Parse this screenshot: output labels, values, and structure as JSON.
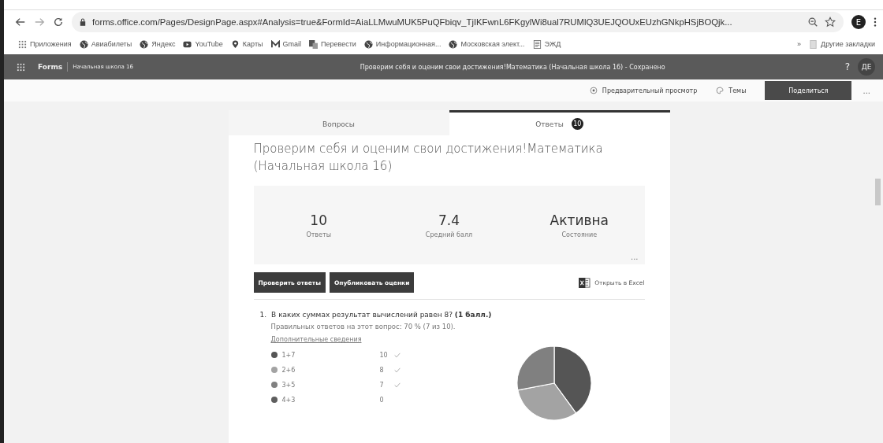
{
  "browser": {
    "url": "forms.office.com/Pages/DesignPage.aspx#Analysis=true&FormId=AiaLLMwuMUK5PuQFbiqv_TjIKFwnL6FKgylWi8ual7RUMlQ3UEJQOUxEUzhGNkpHSjBOQjk...",
    "profile": "E",
    "bookmarks": [
      {
        "label": "Приложения",
        "kind": "apps"
      },
      {
        "label": "Авиабилеты",
        "kind": "globe"
      },
      {
        "label": "Яндекс",
        "kind": "globe"
      },
      {
        "label": "YouTube",
        "kind": "video"
      },
      {
        "label": "Карты",
        "kind": "pin"
      },
      {
        "label": "Gmail",
        "kind": "mail"
      },
      {
        "label": "Перевести",
        "kind": "translate"
      },
      {
        "label": "Информационная...",
        "kind": "globe"
      },
      {
        "label": "Московская элект...",
        "kind": "globe"
      },
      {
        "label": "ЭЖД",
        "kind": "doc"
      }
    ],
    "more": "»",
    "other": "Другие закладки"
  },
  "header": {
    "app": "Forms",
    "group": "Начальная школа 16",
    "title": "Проверим себя и оценим свои достижения!Математика (Начальная школа 16)",
    "status": " - Сохранено",
    "help": "?",
    "avatar": "ДЕ"
  },
  "toolbar": {
    "preview": "Предварительный просмотр",
    "themes": "Темы",
    "share": "Поделиться",
    "more": "..."
  },
  "tabs": [
    {
      "label": "Вопросы",
      "selected": false
    },
    {
      "label": "Ответы",
      "selected": true,
      "badge": "10"
    }
  ],
  "form_title": "Проверим себя и оценим свои достижения!Математика (Начальная школа 16)",
  "stats": [
    {
      "value": "10",
      "label": "Ответы"
    },
    {
      "value": "7.4",
      "label": "Средний балл"
    },
    {
      "value": "Активна",
      "label": "Состояние"
    }
  ],
  "stats_more": "...",
  "buttons": [
    "Проверить ответы",
    "Опубликовать оценки"
  ],
  "excel": "Открыть в Excel",
  "question": {
    "number": "1.",
    "text": "В каких суммах результат вычислений равен 8? **(1 балл.)**",
    "summary": "Правильных ответов на этот вопрос: 70 % (7 из 10).",
    "details": "Дополнительные сведения",
    "options": [
      {
        "count": "10",
        "correct": true,
        "color": "#555555"
      },
      {
        "count": "8",
        "correct": true,
        "color": "#a3a3a3"
      },
      {
        "count": "7",
        "correct": true,
        "color": "#808080"
      },
      {
        "count": "0",
        "correct": false,
        "color": "#5e5e5e"
      }
    ],
    "chart_data": {
      "type": "pie",
      "categories": [
        "1+7",
        "2+6",
        "3+5",
        "4+3"
      ],
      "values": [
        40,
        32,
        28,
        0
      ]
    }
  }
}
